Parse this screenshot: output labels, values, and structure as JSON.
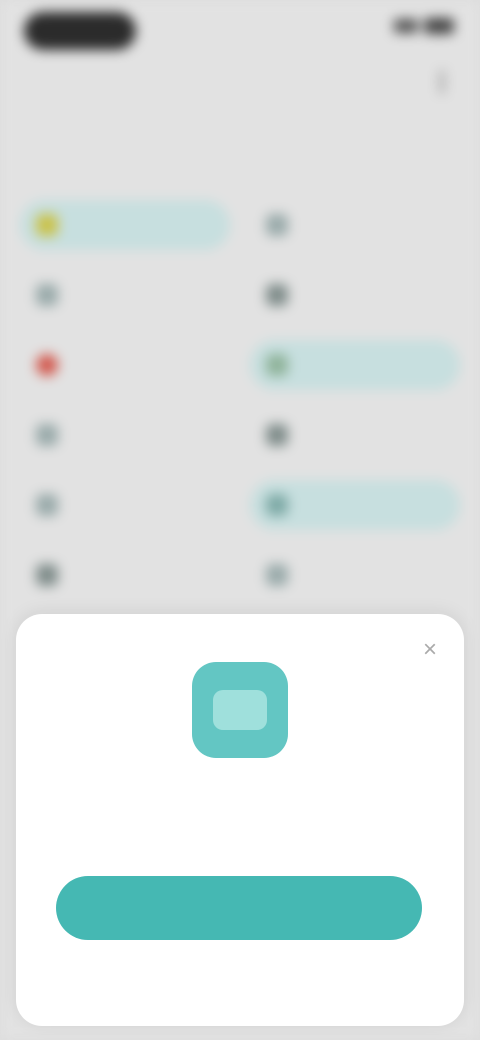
{
  "status_bar": {
    "time": ""
  },
  "nav": {
    "title": ""
  },
  "section": {
    "title": ""
  },
  "items": [
    {
      "label": "",
      "icon": "star-icon",
      "selected": true
    },
    {
      "label": "",
      "icon": "doc-icon",
      "selected": false
    },
    {
      "label": "",
      "icon": "doc-icon",
      "selected": false
    },
    {
      "label": "",
      "icon": "gear-icon",
      "selected": false
    },
    {
      "label": "",
      "icon": "alert-icon",
      "selected": false
    },
    {
      "label": "",
      "icon": "list-icon",
      "selected": true
    },
    {
      "label": "",
      "icon": "doc-icon",
      "selected": false
    },
    {
      "label": "",
      "icon": "tag-icon",
      "selected": false
    },
    {
      "label": "",
      "icon": "doc-icon",
      "selected": false
    },
    {
      "label": "",
      "icon": "folder-icon",
      "selected": true
    },
    {
      "label": "",
      "icon": "doc-icon",
      "selected": false
    },
    {
      "label": "",
      "icon": "doc-icon",
      "selected": false
    }
  ],
  "sheet": {
    "message": "",
    "primary_label": "",
    "secondary_label": "",
    "close_glyph": "×"
  },
  "colors": {
    "accent": "#45b8b3",
    "app_icon": "#63c6c3",
    "chip_selected": "#c7dfdf"
  }
}
